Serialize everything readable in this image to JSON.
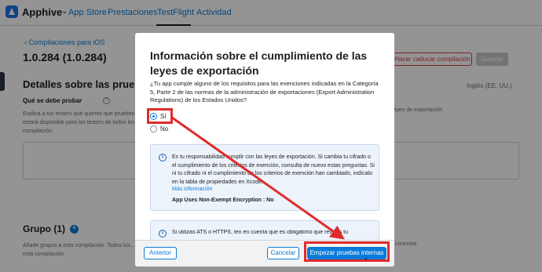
{
  "nav": {
    "brand": "Apphive",
    "items": [
      "App Store",
      "Prestaciones",
      "TestFlight",
      "Actividad"
    ],
    "active": "TestFlight"
  },
  "page": {
    "back_link": "Compilaciones para iOS",
    "version": "1.0.284 (1.0.284)",
    "expire_button": "Hacer caducar compilación",
    "save_button": "Guardar",
    "details_title": "Detalles sobre las pruebas",
    "language": "Inglés (EE. UU.)",
    "what_to_test_label": "Qué se debe probar",
    "what_to_test_desc": "Explica a tus testers qué quieres que prueben… estará disponible para los testers de todos los… compilación.",
    "what_to_test_desc_right": "las leyes de exportación",
    "group_title": "Grupo (1)",
    "group_desc": "Añade grupos a esta compilación. Todos los… esta compilación.",
    "group_desc_right": "concreta."
  },
  "modal": {
    "title": "Información sobre el cumplimiento de las leyes de exportación",
    "question": "¿Tu app cumple alguno de los requisitos para las exenciones indicadas en la Categoría 5, Parte 2 de las normas de la administración de exportaciones (Export Administration Regulations) de los Estados Unidos?",
    "options": [
      {
        "label": "Sí",
        "selected": true
      },
      {
        "label": "No",
        "selected": false
      }
    ],
    "info_text": "Es tu responsabilidad cumplir con las leyes de exportación. Si cambia tu cifrado o el cumplimiento de los criterios de exención, consulta de nuevo estas preguntas. Si ni tu cifrado ni el cumplimiento de los criterios de exención han cambiado, indícalo en la tabla de propiedades en Xcode.",
    "info_link": "Más información",
    "info_bold": "App Uses Non-Exempt Encryption : No",
    "info2_text": "Si utilizas ATS o HTTPS, ten en cuenta que es obligatorio que revises tu",
    "buttons": {
      "previous": "Anterior",
      "cancel": "Cancelar",
      "start": "Empezar pruebas internas"
    }
  },
  "colors": {
    "accent": "#0a7bd8",
    "highlight": "#e02b2b"
  }
}
